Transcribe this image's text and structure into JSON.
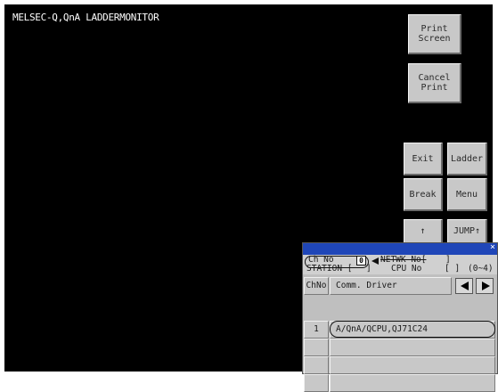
{
  "screen": {
    "title": "MELSEC-Q,QnA LADDERMONITOR"
  },
  "buttons": {
    "print_screen": "Print\nScreen",
    "cancel_print": "Cancel\nPrint",
    "exit": "Exit",
    "ladder": "Ladder",
    "break": "Break",
    "menu": "Menu",
    "up": "↑",
    "jump_up": "JUMP↑"
  },
  "dialog": {
    "close": "×",
    "ch_no_label": "Ch No",
    "ch_no_value": "0",
    "netwk_no_label": "NETWK No[",
    "netwk_no_close": "]",
    "station_label": "STATION [",
    "station_close": "]",
    "cpu_no_label": "CPU No",
    "cpu_no_value": "[  ]",
    "cpu_no_range": "(0~4)",
    "table": {
      "headers": [
        "ChNo",
        "Comm. Driver"
      ],
      "rows": [
        {
          "chno": "1",
          "driver": "A/QnA/QCPU,QJ71C24"
        },
        {
          "chno": "",
          "driver": ""
        },
        {
          "chno": "",
          "driver": ""
        },
        {
          "chno": "",
          "driver": ""
        }
      ]
    }
  }
}
